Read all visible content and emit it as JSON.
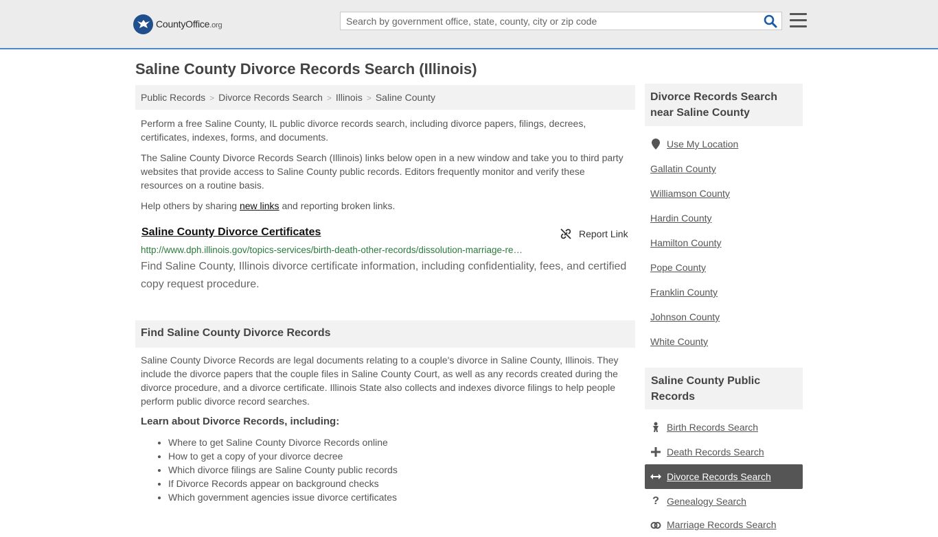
{
  "header": {
    "logo_main": "CountyOffice",
    "logo_tld": ".org",
    "search_placeholder": "Search by government office, state, county, city or zip code"
  },
  "page_title": "Saline County Divorce Records Search (Illinois)",
  "breadcrumb": [
    "Public Records",
    "Divorce Records Search",
    "Illinois",
    "Saline County"
  ],
  "intro": {
    "p1": "Perform a free Saline County, IL public divorce records search, including divorce papers, filings, decrees, certificates, indexes, forms, and documents.",
    "p2": "The Saline County Divorce Records Search (Illinois) links below open in a new window and take you to third party websites that provide access to Saline County public records. Editors frequently monitor and verify these resources on a routine basis.",
    "p3_before": "Help others by sharing ",
    "p3_link": "new links",
    "p3_after": " and reporting broken links."
  },
  "result": {
    "title": "Saline County Divorce Certificates",
    "report_label": "Report Link",
    "url": "http://www.dph.illinois.gov/topics-services/birth-death-other-records/dissolution-marriage-re…",
    "description": "Find Saline County, Illinois divorce certificate information, including confidentiality, fees, and certified copy request procedure."
  },
  "find_section": {
    "heading": "Find Saline County Divorce Records",
    "body": "Saline County Divorce Records are legal documents relating to a couple's divorce in Saline County, Illinois. They include the divorce papers that the couple files in Saline County Court, as well as any records created during the divorce procedure, and a divorce certificate. Illinois State also collects and indexes divorce filings to help people perform public divorce record searches.",
    "learn_heading": "Learn about Divorce Records, including:",
    "learn_items": [
      "Where to get Saline County Divorce Records online",
      "How to get a copy of your divorce decree",
      "Which divorce filings are Saline County public records",
      "If Divorce Records appear on background checks",
      "Which government agencies issue divorce certificates"
    ]
  },
  "sidebar": {
    "nearby_heading": "Divorce Records Search near Saline County",
    "use_location": "Use My Location",
    "counties": [
      "Gallatin County",
      "Williamson County",
      "Hardin County",
      "Hamilton County",
      "Pope County",
      "Franklin County",
      "Johnson County",
      "White County"
    ],
    "public_heading": "Saline County Public Records",
    "public_items": [
      {
        "label": "Birth Records Search",
        "icon": "baby-icon"
      },
      {
        "label": "Death Records Search",
        "icon": "cross-icon"
      },
      {
        "label": "Divorce Records Search",
        "icon": "arrows-horizontal-icon"
      },
      {
        "label": "Genealogy Search",
        "icon": "question-icon"
      },
      {
        "label": "Marriage Records Search",
        "icon": "rings-icon"
      }
    ]
  },
  "colors": {
    "accent_border": "#4a88c7",
    "logo_blue": "#1f4f8c",
    "url_green": "#2a7a3b",
    "search_icon_blue": "#1a5aa8",
    "active_bg": "#555555"
  }
}
